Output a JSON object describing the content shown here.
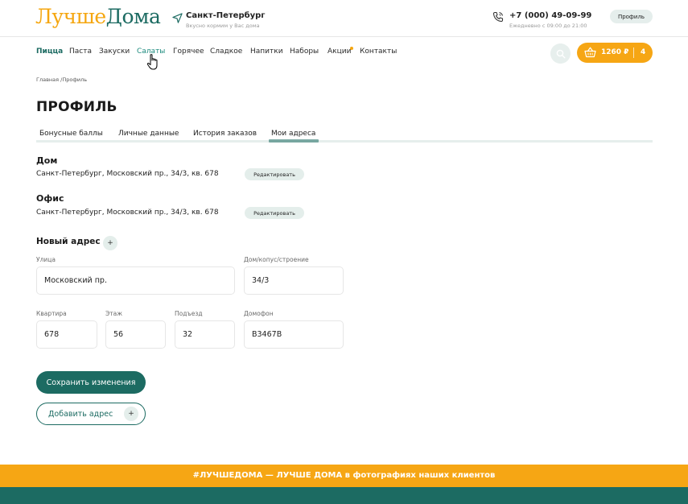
{
  "header": {
    "logo_part1": "Лучше",
    "logo_part2": "Дома",
    "city": "Санкт-Петербург",
    "slogan": "Вкусно кормим у Вас дома",
    "phone": "+7 (000) 49-09-99",
    "hours": "Ежедневно с 09:00 до 21:00",
    "profile_label": "Профиль",
    "icons": [
      "location-arrow-icon",
      "phone-icon"
    ]
  },
  "nav": {
    "items": [
      {
        "label": "Пицца",
        "state": "active"
      },
      {
        "label": "Паста"
      },
      {
        "label": "Закуски"
      },
      {
        "label": "Салаты",
        "state": "hover"
      },
      {
        "label": "Горячее"
      },
      {
        "label": "Сладкое"
      },
      {
        "label": "Напитки"
      },
      {
        "label": "Наборы"
      },
      {
        "label": "Акции",
        "badge": "dot"
      },
      {
        "label": "Контакты"
      }
    ],
    "cart": {
      "sum": "1260 ₽",
      "count": "4"
    }
  },
  "breadcrumb": "Главная /Профиль",
  "page_title": "ПРОФИЛЬ",
  "tabs": [
    {
      "label": "Бонусные баллы"
    },
    {
      "label": "Личные данные"
    },
    {
      "label": "История заказов"
    },
    {
      "label": "Мои адреса",
      "active": true
    }
  ],
  "addresses": [
    {
      "name": "Дом",
      "address": "Санкт-Петербург, Московский пр., 34/3, кв. 678",
      "edit_label": "Редактировать"
    },
    {
      "name": "Офис",
      "address": "Санкт-Петербург, Московский пр., 34/3, кв. 678",
      "edit_label": "Редактировать"
    }
  ],
  "new_address": {
    "title": "Новый адрес",
    "plus": "+",
    "fields": {
      "street": {
        "label": "Улица",
        "value": "Московский пр."
      },
      "house": {
        "label": "Дом/копус/строение",
        "value": "34/3"
      },
      "apartment": {
        "label": "Квартира",
        "value": "678"
      },
      "floor": {
        "label": "Этаж",
        "value": "56"
      },
      "entrance": {
        "label": "Подъезд",
        "value": "32"
      },
      "intercom": {
        "label": "Домофон",
        "value": "В3467В"
      }
    }
  },
  "buttons": {
    "save": "Сохранить изменения",
    "add": "Добавить адрес",
    "add_plus": "+"
  },
  "footer": {
    "banner": "#ЛУЧШЕДОМА — ЛУЧШЕ ДОМА в фотографиях наших клиентов"
  },
  "colors": {
    "brand_green": "#1c6b62",
    "brand_orange": "#f6a614",
    "soft_green": "#e4eeeb"
  }
}
